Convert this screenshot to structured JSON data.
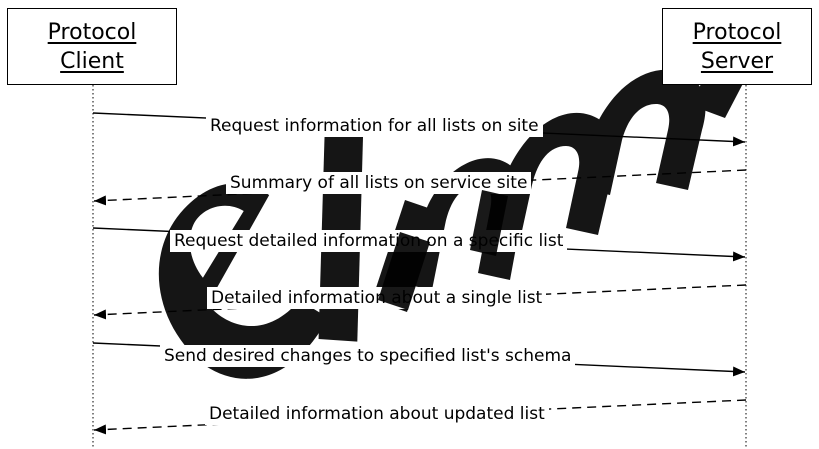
{
  "participants": {
    "client": {
      "line1": "Protocol",
      "line2": "Client"
    },
    "server": {
      "line1": "Protocol",
      "line2": "Server"
    }
  },
  "messages": [
    {
      "label": "Request information for all lists on site",
      "direction": "client-to-server",
      "style": "solid"
    },
    {
      "label": "Summary of all lists on service site",
      "direction": "server-to-client",
      "style": "dashed"
    },
    {
      "label": "Request detailed information on a specific list",
      "direction": "client-to-server",
      "style": "solid"
    },
    {
      "label": "Detailed information about a single list",
      "direction": "server-to-client",
      "style": "dashed"
    },
    {
      "label": "Send desired changes to specified list's schema",
      "direction": "client-to-server",
      "style": "solid"
    },
    {
      "label": "Detailed information about updated list",
      "direction": "server-to-client",
      "style": "dashed"
    }
  ],
  "colors": {
    "line": "#000000",
    "watermark": "#000000"
  }
}
